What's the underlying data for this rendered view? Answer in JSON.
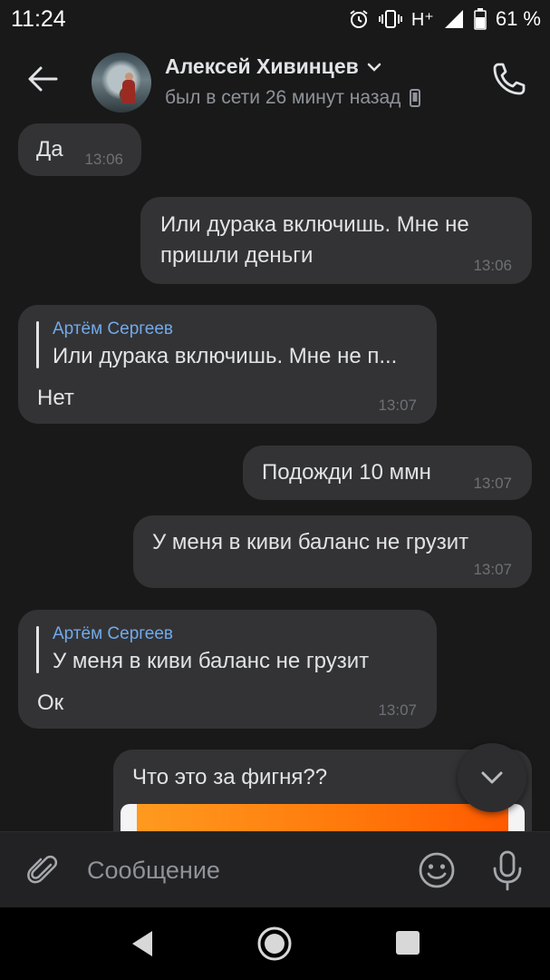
{
  "status_bar": {
    "time": "11:24",
    "network": "H⁺",
    "battery": "61 %",
    "icons": [
      "alarm-icon",
      "vibrate-icon",
      "signal-icon",
      "battery-icon"
    ]
  },
  "header": {
    "contact_name": "Алексей Хивинцев",
    "last_seen": "был в сети 26 минут назад",
    "icons": [
      "back-arrow-icon",
      "chevron-down-icon",
      "mobile-device-icon",
      "phone-call-icon"
    ]
  },
  "messages": [
    {
      "direction": "incoming",
      "text": "Да",
      "time": "13:06"
    },
    {
      "direction": "outgoing",
      "text_line1": "Или дурака включишь. Мне не",
      "text_line2": "пришли деньги",
      "time": "13:06"
    },
    {
      "direction": "incoming",
      "reply_author": "Артём Сергеев",
      "reply_text": "Или дурака включишь. Мне не п...",
      "text": "Нет",
      "time": "13:07"
    },
    {
      "direction": "outgoing",
      "text": "Подожди 10 ммн",
      "time": "13:07"
    },
    {
      "direction": "outgoing",
      "text": "У меня в киви баланс не грузит",
      "time": "13:07"
    },
    {
      "direction": "incoming",
      "reply_author": "Артём Сергеев",
      "reply_text": "У меня в киви баланс не грузит",
      "text": "Ок",
      "time": "13:07"
    },
    {
      "direction": "outgoing",
      "text": "Что это за фигня??",
      "has_image": true
    }
  ],
  "composer": {
    "placeholder": "Сообщение",
    "icons": [
      "paperclip-icon",
      "emoji-icon",
      "microphone-icon"
    ]
  },
  "colors": {
    "background": "#19191a",
    "bubble": "#333335",
    "accent_link": "#71aaeb",
    "text_secondary": "#8f9399"
  }
}
